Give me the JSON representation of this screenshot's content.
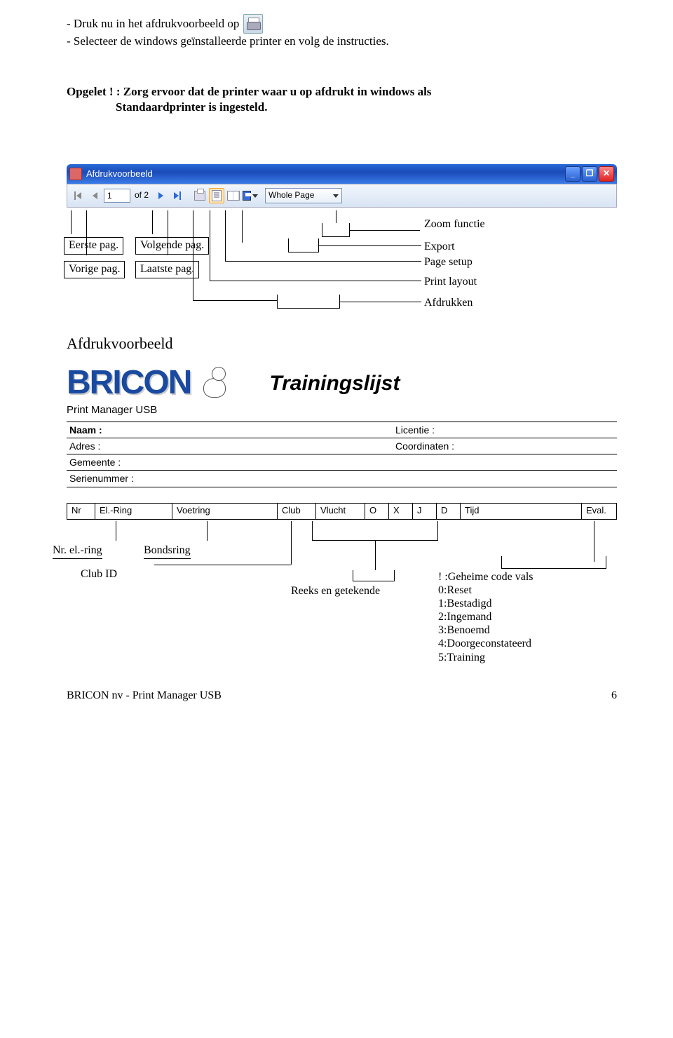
{
  "intro": {
    "line1": "- Druk nu in het afdrukvoorbeeld op",
    "line2": "- Selecteer de windows geïnstalleerde printer en volg de instructies."
  },
  "opgelet": {
    "lead": "Opgelet ! : ",
    "rest1": "Zorg ervoor dat de printer waar u op afdrukt in windows als",
    "rest2": "Standaardprinter is ingesteld."
  },
  "window": {
    "title": "Afdrukvoorbeeld",
    "page_current": "1",
    "page_of": "of",
    "page_total": "2",
    "zoom_label": "Whole Page"
  },
  "annotations": {
    "eerste": "Eerste pag.",
    "volgende": "Volgende pag.",
    "vorige": "Vorige pag.",
    "laatste": "Laatste pag.",
    "zoom": "Zoom functie",
    "export": "Export",
    "page_setup": "Page setup",
    "print_layout": "Print layout",
    "afdrukken": "Afdrukken"
  },
  "preview_heading": "Afdrukvoorbeeld",
  "preview": {
    "logo": "BRICON",
    "title": "Trainingslijst",
    "subtitle": "Print Manager USB",
    "labels": {
      "naam": "Naam :",
      "adres": "Adres :",
      "gemeente": "Gemeente :",
      "serienr": "Serienummer :",
      "licentie": "Licentie :",
      "coord": "Coordinaten :"
    },
    "cols": [
      "Nr",
      "El.-Ring",
      "Voetring",
      "Club",
      "Vlucht",
      "O",
      "X",
      "J",
      "D",
      "Tijd",
      "Eval."
    ]
  },
  "bottom": {
    "nr": "Nr. el.-ring",
    "bonds": "Bondsring",
    "club": "Club ID",
    "reeks": "Reeks en getekende",
    "codes": [
      "! :Geheime code vals",
      "0:Reset",
      "1:Bestadigd",
      "2:Ingemand",
      "3:Benoemd",
      "4:Doorgeconstateerd",
      "5:Training"
    ]
  },
  "footer": {
    "left": "BRICON nv - Print Manager USB",
    "page": "6"
  }
}
